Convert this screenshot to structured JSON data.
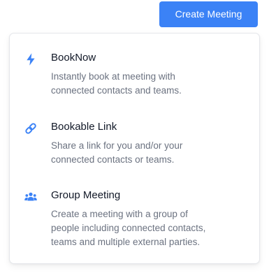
{
  "header": {
    "create_meeting_label": "Create Meeting"
  },
  "menu": {
    "items": [
      {
        "title": "BookNow",
        "icon": "lightning-bolt-icon",
        "description_lines": [
          "Instantly book at meeting with",
          "connected contacts and teams."
        ]
      },
      {
        "title": "Bookable Link",
        "icon": "link-icon",
        "description_lines": [
          "Share a link for you and/or your",
          "connected contacts or teams."
        ]
      },
      {
        "title": "Group Meeting",
        "icon": "people-group-icon",
        "description_lines": [
          "Create a meeting with a group of",
          "people including connected contacts,",
          "teams and multiple external parties."
        ]
      }
    ]
  },
  "colors": {
    "accent": "#3b82f6",
    "title_text": "#111827",
    "description_text": "#6b7280"
  }
}
